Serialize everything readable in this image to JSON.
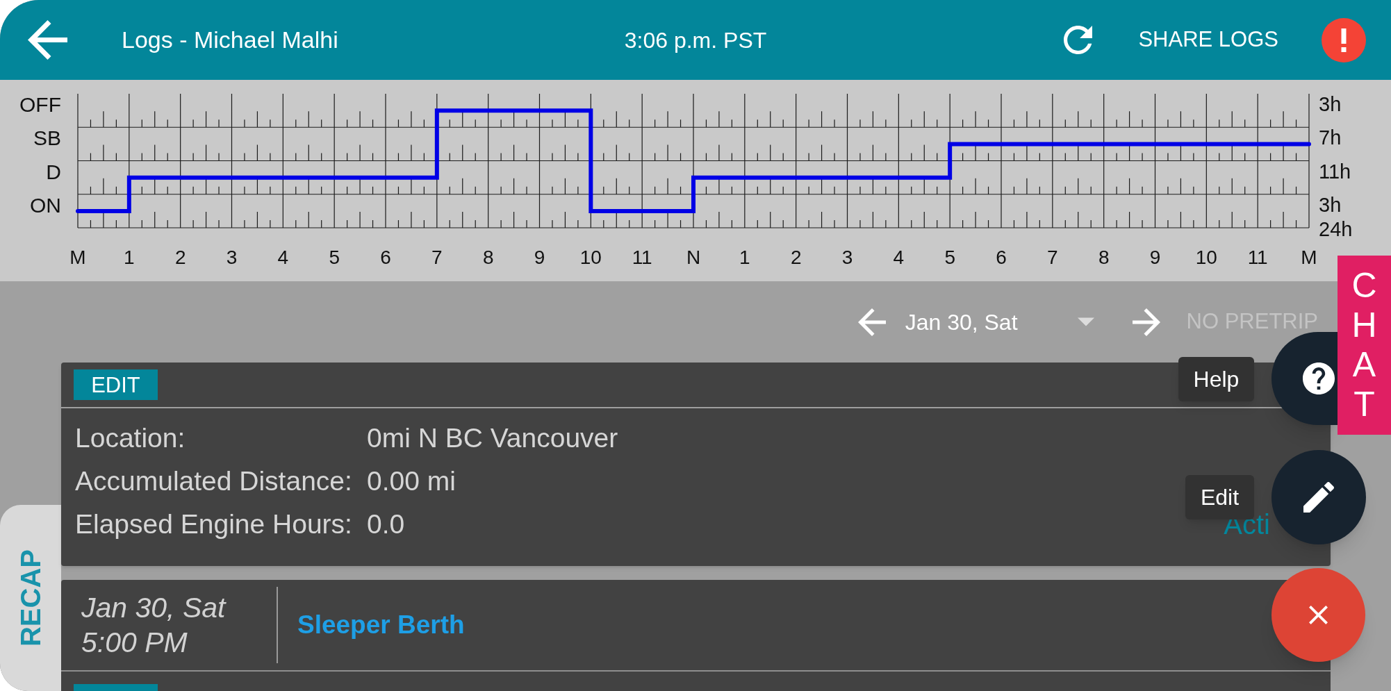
{
  "header": {
    "title": "Logs - Michael Malhi",
    "time": "3:06 p.m. PST",
    "share_label": "SHARE LOGS"
  },
  "log_graph": {
    "rows": [
      {
        "kind": "off",
        "label": "OFF",
        "total": "3h"
      },
      {
        "kind": "sleeper",
        "label": "SB",
        "total": "7h"
      },
      {
        "kind": "driving",
        "label": "D",
        "total": "11h"
      },
      {
        "kind": "on",
        "label": "ON",
        "total": "3h"
      }
    ],
    "day_total": "24h",
    "hour_labels": [
      "M",
      "1",
      "2",
      "3",
      "4",
      "5",
      "6",
      "7",
      "8",
      "9",
      "10",
      "11",
      "N",
      "1",
      "2",
      "3",
      "4",
      "5",
      "6",
      "7",
      "8",
      "9",
      "10",
      "11",
      "M"
    ],
    "hours": [
      {
        "kind": "on"
      },
      {
        "kind": "driving"
      },
      {
        "kind": "driving"
      },
      {
        "kind": "driving"
      },
      {
        "kind": "driving"
      },
      {
        "kind": "driving"
      },
      {
        "kind": "driving"
      },
      {
        "kind": "off"
      },
      {
        "kind": "off"
      },
      {
        "kind": "off"
      },
      {
        "kind": "on"
      },
      {
        "kind": "on"
      },
      {
        "kind": "driving"
      },
      {
        "kind": "driving"
      },
      {
        "kind": "driving"
      },
      {
        "kind": "driving"
      },
      {
        "kind": "driving"
      },
      {
        "kind": "sleeper"
      },
      {
        "kind": "sleeper"
      },
      {
        "kind": "sleeper"
      },
      {
        "kind": "sleeper"
      },
      {
        "kind": "sleeper"
      },
      {
        "kind": "sleeper"
      },
      {
        "kind": "sleeper"
      }
    ]
  },
  "date_nav": {
    "date": "Jan 30, Sat",
    "pretrip": {
      "label": "NO PRETRIP",
      "disabled": true
    }
  },
  "summary": {
    "edit_label": "EDIT",
    "fields": [
      {
        "label": "Location:",
        "value": "0mi N BC Vancouver"
      },
      {
        "label": "Accumulated Distance:",
        "value": "0.00 mi"
      },
      {
        "label": "Elapsed Engine Hours:",
        "value": "0.0"
      }
    ],
    "status": "Acti"
  },
  "events": [
    {
      "kind": "status",
      "date": "Jan 30, Sat",
      "time": "5:00 PM",
      "status": "Sleeper Berth"
    },
    {
      "kind": "badge"
    }
  ],
  "floating_actions": [
    {
      "kind": "help",
      "tooltip": "Help"
    },
    {
      "kind": "edit",
      "tooltip": "Edit"
    },
    {
      "kind": "close"
    }
  ],
  "chat_tab": {
    "label": "CHAT"
  },
  "recap_tab": {
    "label": "RECAP"
  }
}
